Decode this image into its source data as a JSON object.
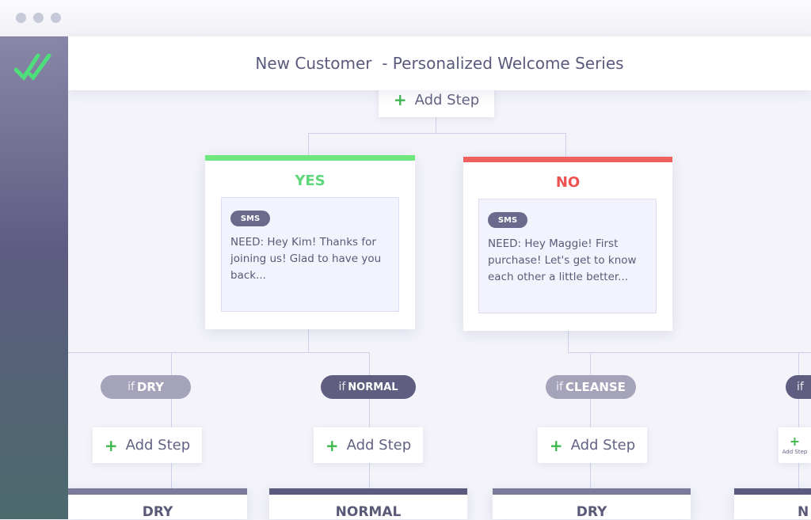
{
  "window": {
    "controls": [
      "close",
      "minimize",
      "maximize"
    ]
  },
  "sidebar": {
    "logo_icon": "double-check-icon",
    "logo_color": "#4de07a"
  },
  "header": {
    "title": "New Customer  - Personalized Welcome Series"
  },
  "add_step_label": "Add Step",
  "branches": {
    "yes": {
      "title": "YES",
      "color": "#6ee77f",
      "badge": "SMS",
      "message": "NEED: Hey Kim! Thanks for joining us! Glad to have you back..."
    },
    "no": {
      "title": "NO",
      "color": "#f0605e",
      "badge": "SMS",
      "message": "NEED: Hey Maggie! First purchase! Let's get to know each other a little better..."
    }
  },
  "conditions": [
    {
      "prefix": "if",
      "value": "DRY"
    },
    {
      "prefix": "if",
      "value": "NORMAL"
    },
    {
      "prefix": "if",
      "value": "CLEANSE"
    },
    {
      "prefix": "if",
      "value": ""
    }
  ],
  "bottom_cards": [
    "DRY",
    "NORMAL",
    "DRY",
    "N"
  ]
}
